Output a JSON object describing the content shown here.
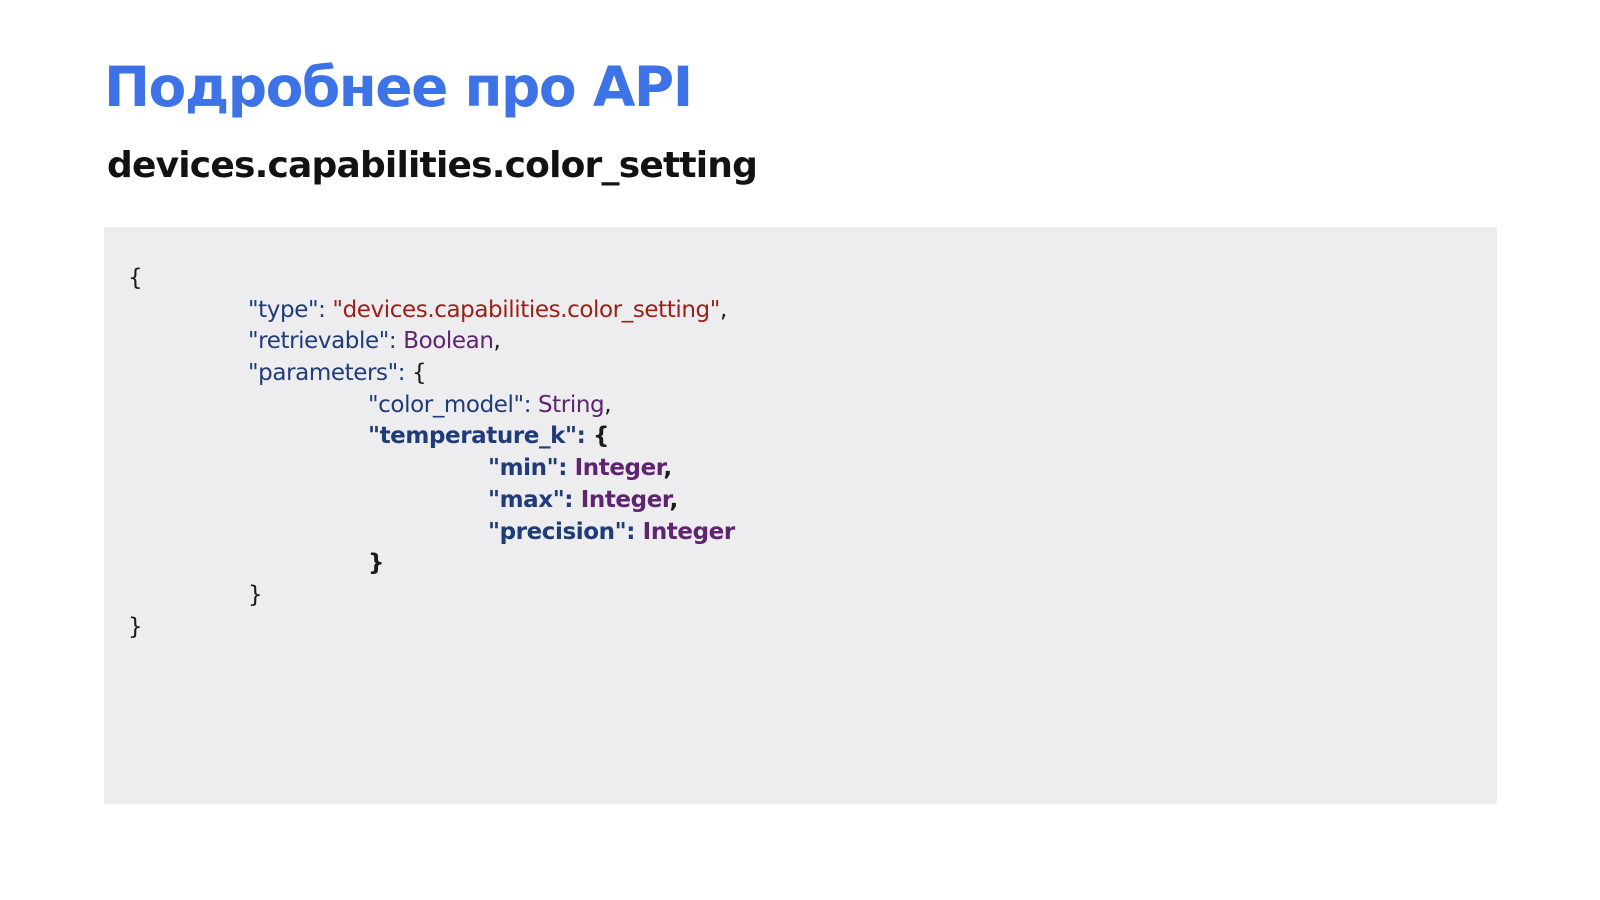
{
  "colors": {
    "background": "#ffffff",
    "title": "#3d73e6",
    "subtitle": "#121212",
    "code_background": "#ededef",
    "punctuation": "#1a1a1a",
    "key": "#1f3b78",
    "string_value": "#9c2019",
    "type_value": "#5e2470"
  },
  "slide": {
    "title": "Подробнее про API",
    "subtitle": "devices.capabilities.color_setting"
  },
  "code": {
    "open_brace": "{",
    "type_key": "\"type\"",
    "type_colon": ": ",
    "type_value": "\"devices.capabilities.color_setting\"",
    "type_comma": ",",
    "retrievable_key": "\"retrievable\"",
    "retrievable_colon": ": ",
    "retrievable_value": "Boolean",
    "retrievable_comma": ",",
    "parameters_key": "\"parameters\"",
    "parameters_colon": ": ",
    "parameters_open": "{",
    "color_model_key": "\"color_model\"",
    "color_model_colon": ": ",
    "color_model_value": "String",
    "color_model_comma": ",",
    "temperature_key": "\"temperature_k\"",
    "temperature_colon": ": ",
    "temperature_open": "{",
    "min_key": "\"min\"",
    "min_colon": ": ",
    "min_value": "Integer",
    "min_comma": ",",
    "max_key": "\"max\"",
    "max_colon": ": ",
    "max_value": "Integer",
    "max_comma": ",",
    "precision_key": "\"precision\"",
    "precision_colon": ": ",
    "precision_value": "Integer",
    "temperature_close": "}",
    "parameters_close": "}",
    "close_brace": "}"
  }
}
